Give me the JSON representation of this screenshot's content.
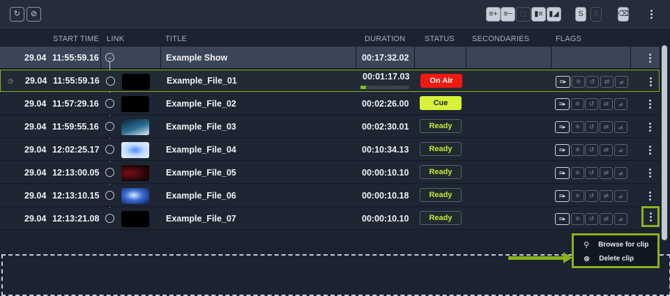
{
  "toolbar": {
    "left_icons": [
      "refresh-icon",
      "no-timer-icon"
    ],
    "right_icons": [
      "add-item-icon",
      "remove-item-icon",
      "lock-icon",
      "list-view-icon",
      "segment-icon",
      "script-icon",
      "script-disabled-icon",
      "trash-icon",
      "more-icon"
    ]
  },
  "columns": {
    "start_time": "START TIME",
    "link": "LINK",
    "title": "TITLE",
    "duration": "DURATION",
    "status": "STATUS",
    "secondaries": "SECONDARIES",
    "flags": "FLAGS"
  },
  "show": {
    "date": "29.04",
    "time": "11:55:59.16",
    "title": "Example Show",
    "duration": "00:17:32.02"
  },
  "rows": [
    {
      "date": "29.04",
      "time": "11:55:59.16",
      "title": "Example_File_01",
      "duration": "00:01:17.03",
      "status": "On Air",
      "progress": 0.12
    },
    {
      "date": "29.04",
      "time": "11:57:29.16",
      "title": "Example_File_02",
      "duration": "00:02:26.00",
      "status": "Cue"
    },
    {
      "date": "29.04",
      "time": "11:59:55.16",
      "title": "Example_File_03",
      "duration": "00:02:30.01",
      "status": "Ready"
    },
    {
      "date": "29.04",
      "time": "12:02:25.17",
      "title": "Example_File_04",
      "duration": "00:10:34.13",
      "status": "Ready"
    },
    {
      "date": "29.04",
      "time": "12:13:00.05",
      "title": "Example_File_05",
      "duration": "00:00:10.10",
      "status": "Ready"
    },
    {
      "date": "29.04",
      "time": "12:13:10.15",
      "title": "Example_File_06",
      "duration": "00:00:10.18",
      "status": "Ready"
    },
    {
      "date": "29.04",
      "time": "12:13:21.08",
      "title": "Example_File_07",
      "duration": "00:00:10.10",
      "status": "Ready"
    }
  ],
  "context_menu": {
    "browse": "Browse for clip",
    "delete": "Delete clip"
  },
  "colors": {
    "on_air": "#f0190f",
    "cue": "#d8f23a",
    "ready_text": "#c5e833",
    "highlight": "#8ab41c"
  }
}
